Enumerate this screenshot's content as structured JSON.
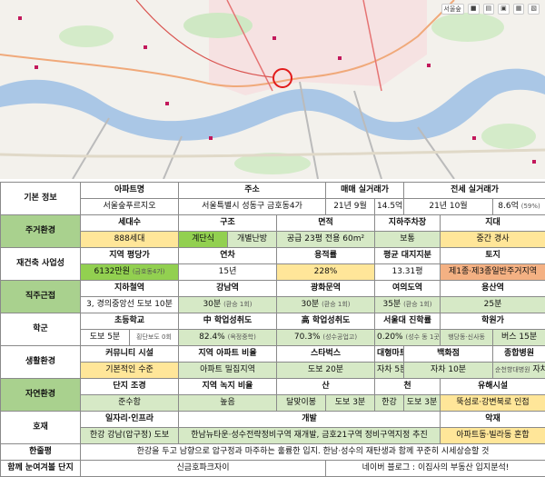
{
  "map": {
    "toolbar": [
      "서울숲",
      "■",
      "▤",
      "▣",
      "▦",
      "▧"
    ]
  },
  "basic": {
    "category": "기본 정보",
    "h_name": "아파트명",
    "name": "서울숲푸르지오",
    "h_addr": "주소",
    "addr": "서울특별시 성동구 금호동4가",
    "h_sale": "매매 실거래가",
    "sale_date": "21년 9월",
    "sale_price": "14.5억",
    "h_jeonse": "전세 실거래가",
    "jeonse_date": "21년 10월",
    "jeonse_price": "8.6억",
    "jeonse_ratio": "(59%)"
  },
  "living": {
    "category": "주거환경",
    "h_households": "세대수",
    "households": "888세대",
    "h_structure": "구조",
    "structure": "계단식",
    "heating": "개별난방",
    "h_area": "면적",
    "area": "공급 23평  전용 60m²",
    "h_parking": "지하주차장",
    "parking": "보통",
    "h_terrain": "지대",
    "terrain": "중간 경사"
  },
  "rebuild": {
    "category": "재건축 사업성",
    "h_land_price": "지역 평당가",
    "land_price": "6132만원",
    "land_price_sub": "(금호동4가)",
    "h_age": "연차",
    "age": "15년",
    "h_far": "용적률",
    "far": "228%",
    "h_land_share": "평균 대지지분",
    "land_share": "13.31평",
    "h_land": "토지",
    "land": "제1종·제3종일반주거지역"
  },
  "commute": {
    "category": "직주근접",
    "h_nearest": "지하철역",
    "nearest": "3, 경의중앙선  도보 10분",
    "h_gangnam": "강남역",
    "gangnam": "30분",
    "gangnam_sub": "(환승 1회)",
    "h_gwanghwamun": "광화문역",
    "gwanghwamun": "30분",
    "gwanghwamun_sub": "(환승 1회)",
    "h_yeouido": "여의도역",
    "yeouido": "35분",
    "yeouido_sub": "(환승 1회)",
    "h_yongsan": "용산역",
    "yongsan": "25분"
  },
  "school": {
    "category": "학군",
    "h_elem": "초등학교",
    "elem": "도보 5분",
    "elem_sub": "횡단보도 0회",
    "h_mid": "中 학업성취도",
    "mid": "82.4%",
    "mid_sub": "(옥정중학)",
    "h_high": "高 학업성취도",
    "high": "70.3%",
    "high_sub": "(성수공업고)",
    "h_univ": "서울대 진학률",
    "univ": "0.20%",
    "univ_sub": "(성수 동 1곳)",
    "h_academy": "학원가",
    "academy_sub": "행당동·신사동",
    "academy": "버스 15분"
  },
  "life": {
    "category": "생활환경",
    "h_convenience": "커뮤니티 시설",
    "convenience": "기본적인 수준",
    "h_ratio": "지역 아파트 비율",
    "ratio": "아파트 밀집지역",
    "h_starbucks": "스타벅스",
    "starbucks": "도보 20분",
    "h_mart": "대형마트",
    "mart": "자차 5분",
    "h_dept": "백화점",
    "dept": "자차 10분",
    "h_hospital": "종합병원",
    "hospital_sub": "순천향대병원",
    "hospital": "자차 10분"
  },
  "nature": {
    "category": "자연환경",
    "h_landscape": "단지 조경",
    "landscape": "준수함",
    "h_green": "지역 녹지 비율",
    "green": "높음",
    "h_mountain": "산",
    "mountain": "달맞이봉",
    "mountain_time": "도보 3분",
    "h_stream": "천",
    "stream": "한강",
    "stream_time": "도보 3분",
    "h_facility": "유해시설",
    "facility": "뚝섬로·강변북로 인접"
  },
  "positive": {
    "category": "호재",
    "h_infra": "일자리·인프라",
    "infra": "한강 강남(압구정) 도보",
    "h_dev": "개발",
    "dev": "한남뉴타운·성수전략정비구역 재개발, 금호21구역 정비구역지정 추진",
    "h_negative": "악재",
    "negative": "아파트동·빌라동 혼합"
  },
  "summary": {
    "category": "한줄평",
    "text": "한강을 두고 남향으로 압구정과 마주하는 훌륭한 입지. 한남·성수의 재탄생과 함께 꾸준히 시세상승할 것"
  },
  "compare": {
    "category": "함께 눈여겨볼 단지",
    "text": "신금호파크자이",
    "credit": "네이버 블로그 : 이집사의 부동산 입지분석!"
  }
}
